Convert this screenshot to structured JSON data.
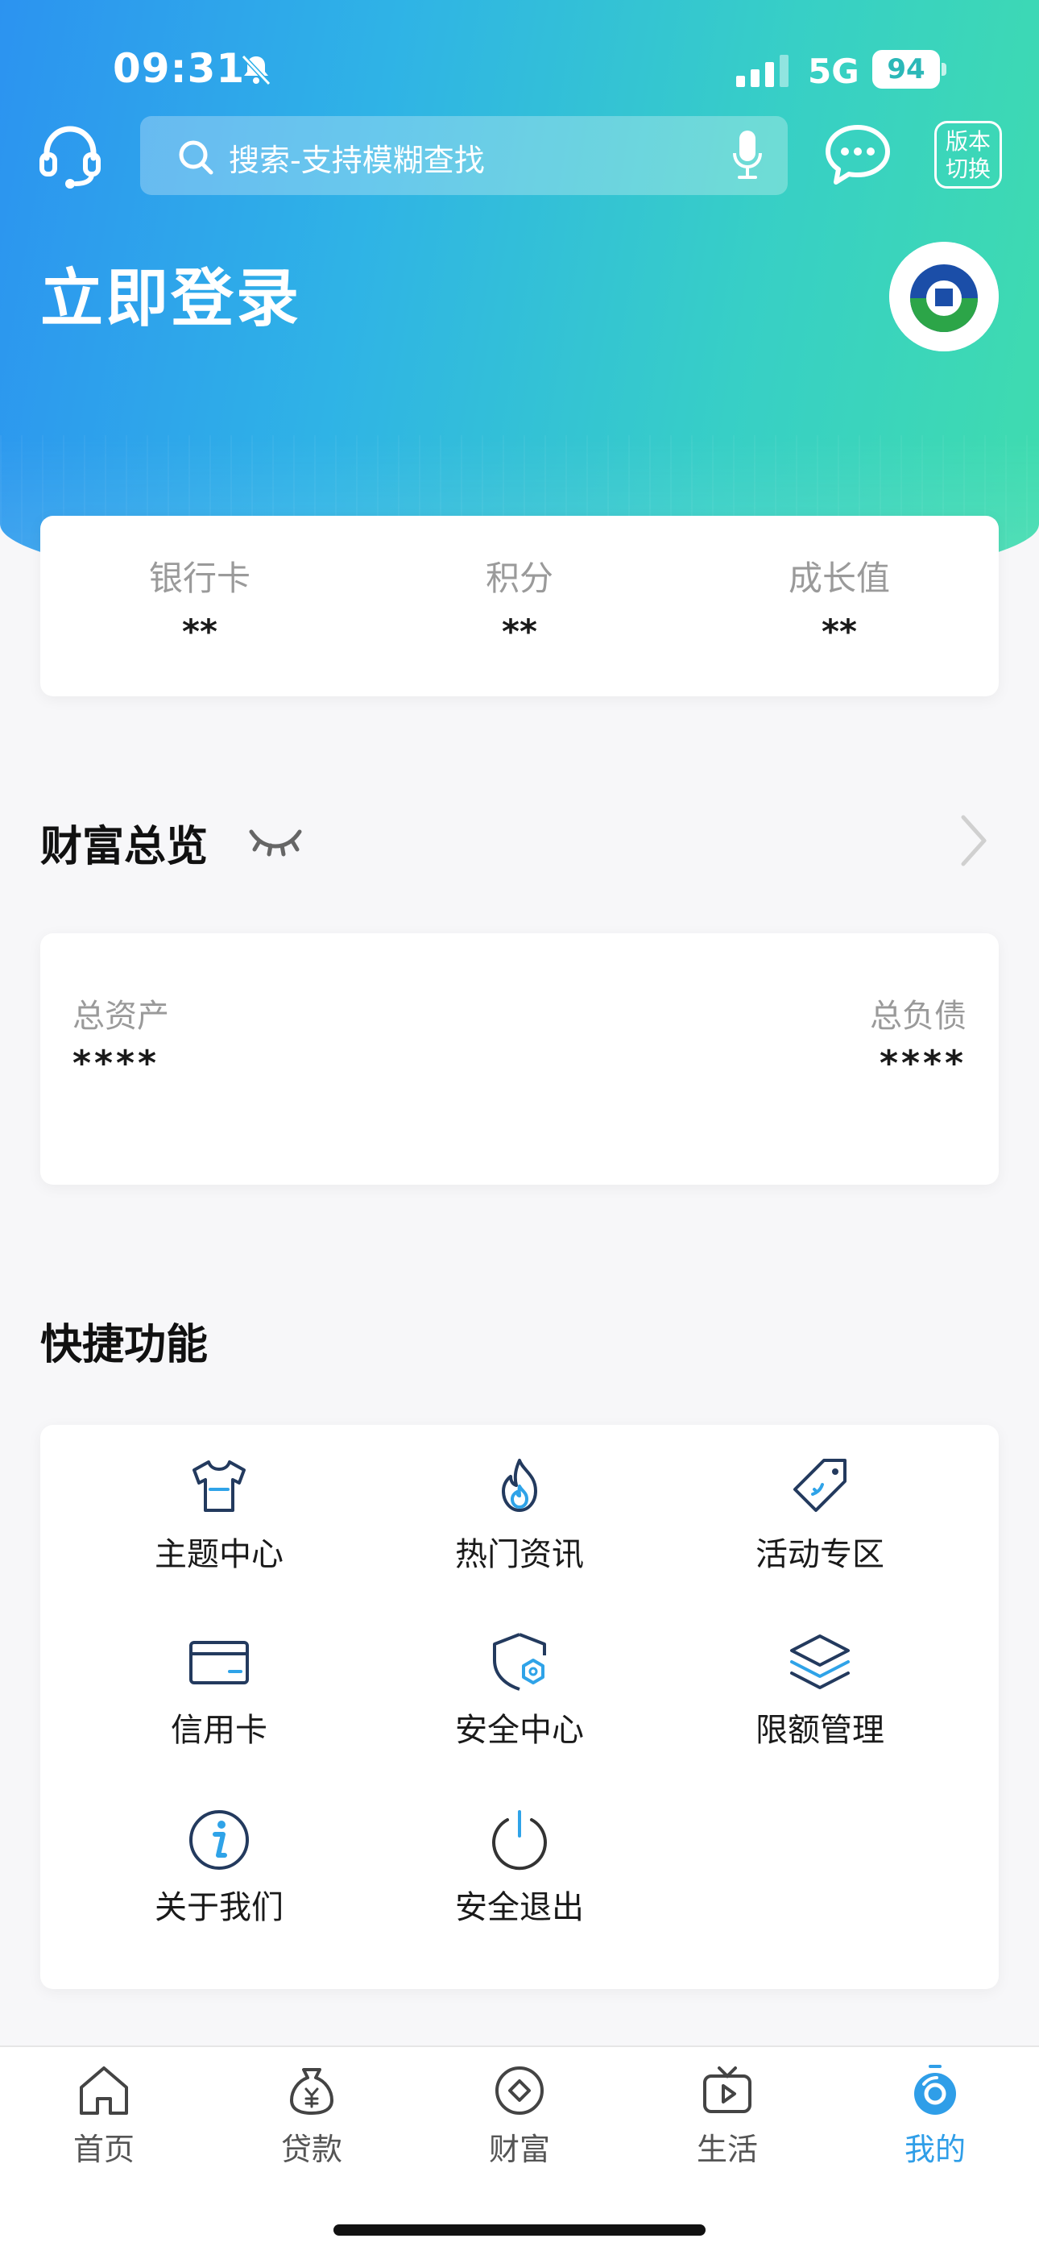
{
  "status_bar": {
    "time": "09:31",
    "network": "5G",
    "battery": "94"
  },
  "header": {
    "search_placeholder": "搜索-支持模糊查找",
    "switch_line1": "版本",
    "switch_line2": "切换",
    "login_text": "立即登录"
  },
  "stats": [
    {
      "label": "银行卡",
      "value": "**"
    },
    {
      "label": "积分",
      "value": "**"
    },
    {
      "label": "成长值",
      "value": "**"
    }
  ],
  "wealth": {
    "title": "财富总览",
    "assets_label": "总资产",
    "assets_value": "****",
    "liabilities_label": "总负债",
    "liabilities_value": "****"
  },
  "quick": {
    "title": "快捷功能",
    "items": [
      {
        "label": "主题中心",
        "icon": "shirt-icon"
      },
      {
        "label": "热门资讯",
        "icon": "flame-icon"
      },
      {
        "label": "活动专区",
        "icon": "tag-icon"
      },
      {
        "label": "信用卡",
        "icon": "credit-card-icon"
      },
      {
        "label": "安全中心",
        "icon": "shield-icon"
      },
      {
        "label": "限额管理",
        "icon": "layers-icon"
      },
      {
        "label": "关于我们",
        "icon": "info-icon"
      },
      {
        "label": "安全退出",
        "icon": "power-icon"
      }
    ]
  },
  "tabs": [
    {
      "label": "首页",
      "icon": "home-icon"
    },
    {
      "label": "贷款",
      "icon": "money-bag-icon"
    },
    {
      "label": "财富",
      "icon": "diamond-icon"
    },
    {
      "label": "生活",
      "icon": "tv-icon"
    },
    {
      "label": "我的",
      "icon": "profile-icon",
      "active": true
    }
  ],
  "colors": {
    "accent": "#2f9ee8",
    "hero_start": "#2c93f0",
    "hero_end": "#3fdcae"
  }
}
